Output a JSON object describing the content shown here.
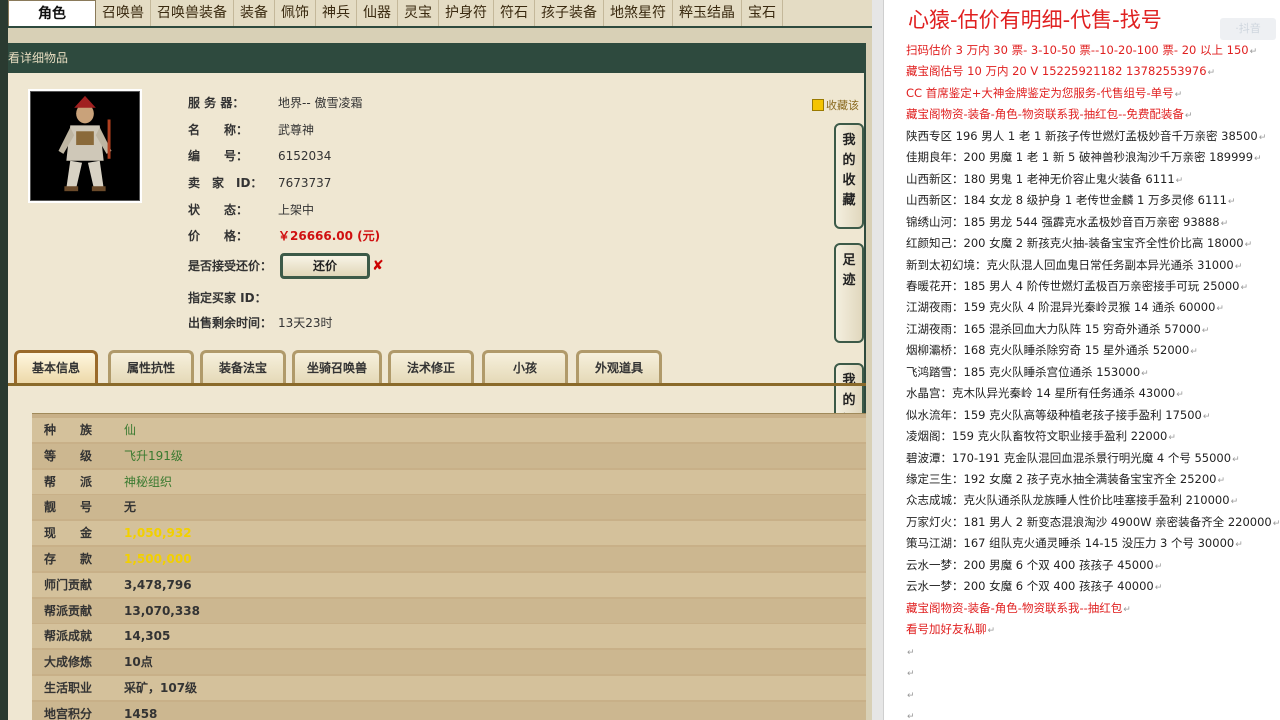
{
  "nav": {
    "tabs": [
      "角色",
      "召唤兽",
      "召唤兽装备",
      "装备",
      "佩饰",
      "神兵",
      "仙器",
      "灵宝",
      "护身符",
      "符石",
      "孩子装备",
      "地煞星符",
      "粹玉结晶",
      "宝石"
    ],
    "active_index": 0
  },
  "header": {
    "title": "看详细物品"
  },
  "item": {
    "fields": [
      {
        "label": "服 务 器：",
        "value": "地界-- 傲雪凌霜"
      },
      {
        "label": "名　　称：",
        "value": "武尊神"
      },
      {
        "label": "编　　号：",
        "value": "6152034"
      },
      {
        "label": "卖　家　ID：",
        "value": "7673737"
      },
      {
        "label": "状　　态：",
        "value": "上架中"
      },
      {
        "label": "价　　格：",
        "value": "￥26666.00 (元)"
      },
      {
        "label": "是否接受还价：",
        "value": ""
      },
      {
        "label": "指定买家 ID：",
        "value": ""
      },
      {
        "label": "出售剩余时间：",
        "value": "13天23时"
      }
    ],
    "counter_offer_button": "还价",
    "favorite_link": "收藏该",
    "side_buttons": [
      "我的收藏",
      "足迹",
      "我的还价"
    ]
  },
  "info_tabs": [
    "基本信息",
    "属性抗性",
    "装备法宝",
    "坐骑召唤兽",
    "法术修正",
    "小孩",
    "外观道具"
  ],
  "info_active": 0,
  "stats": [
    {
      "k": "种　　族",
      "v": "仙",
      "style": "green"
    },
    {
      "k": "等　　级",
      "v": "飞升191级",
      "style": "green"
    },
    {
      "k": "帮　　派",
      "v": "神秘组织",
      "style": "green"
    },
    {
      "k": "靓　　号",
      "v": "无",
      "style": "plain"
    },
    {
      "k": "现　　金",
      "v": "1,050,932",
      "style": "yellow"
    },
    {
      "k": "存　　款",
      "v": "1,500,000",
      "style": "yellow"
    },
    {
      "k": "师门贡献",
      "v": "3,478,796",
      "style": "plain"
    },
    {
      "k": "帮派贡献",
      "v": "13,070,338",
      "style": "plain"
    },
    {
      "k": "帮派成就",
      "v": "14,305",
      "style": "plain"
    },
    {
      "k": "大成修炼",
      "v": "10点",
      "style": "plain"
    },
    {
      "k": "生活职业",
      "v": "采矿，107级",
      "style": "plain"
    },
    {
      "k": "地宫积分",
      "v": "1458",
      "style": "plain"
    }
  ],
  "notes": {
    "title": "心猿-估价有明细-代售-找号",
    "watermark": "·抖音",
    "lines": [
      {
        "t": "扫码估价 3 万内 30 票- 3-10-50 票--10-20-100 票- 20 以上 150",
        "c": "red"
      },
      {
        "t": "藏宝阁估号 10 万内 20 V 15225921182    13782553976",
        "c": "red"
      },
      {
        "t": "CC 首席鉴定+大神金牌鉴定为您服务-代售组号-单号",
        "c": "red"
      },
      {
        "t": "藏宝阁物资-装备-角色-物资联系我-抽红包--免费配装备",
        "c": "red"
      },
      {
        "t": "陕西专区 196 男人 1 老 1 新孩子传世燃灯孟极妙音千万亲密 38500",
        "c": "black"
      },
      {
        "t": "佳期良年：200 男魔 1 老 1 新 5 破神兽秒浪淘沙千万亲密 189999",
        "c": "black"
      },
      {
        "t": "山西新区：180 男鬼 1 老神无价容止鬼火装备 6111",
        "c": "black"
      },
      {
        "t": "山西新区：184 女龙 8 级护身 1 老传世金麟 1 万多灵修 6111",
        "c": "black"
      },
      {
        "t": "锦绣山河：185 男龙 544 强霹克水孟极妙音百万亲密 93888",
        "c": "black"
      },
      {
        "t": "红颜知己：200 女魔 2 新孩克火抽-装备宝宝齐全性价比高 18000",
        "c": "black"
      },
      {
        "t": "新到太初幻境：克火队混人回血鬼日常任务副本异光通杀 31000",
        "c": "black"
      },
      {
        "t": "春暖花开：185 男人 4 阶传世燃灯孟极百万亲密接手可玩 25000",
        "c": "black"
      },
      {
        "t": "江湖夜雨：159 克火队 4 阶混异光秦岭灵猴 14 通杀 60000",
        "c": "black"
      },
      {
        "t": "江湖夜雨：165 混杀回血大力队阵 15 穷奇外通杀 57000",
        "c": "black"
      },
      {
        "t": "烟柳灞桥：168 克火队睡杀除穷奇 15 星外通杀 52000",
        "c": "black"
      },
      {
        "t": "飞鸿踏雪：185 克火队睡杀宫位通杀 153000",
        "c": "black"
      },
      {
        "t": "水晶宫：克木队异光秦岭 14 星所有任务通杀 43000",
        "c": "black"
      },
      {
        "t": "似水流年：159 克火队高等级种植老孩子接手盈利 17500",
        "c": "black"
      },
      {
        "t": "凌烟阁：159 克火队畜牧符文职业接手盈利 22000",
        "c": "black"
      },
      {
        "t": "碧波潭：170-191 克金队混回血混杀景行明光魔 4 个号 55000",
        "c": "black"
      },
      {
        "t": "缘定三生：192 女魔 2 孩子克水抽全满装备宝宝齐全 25200",
        "c": "black"
      },
      {
        "t": "众志成城：克火队通杀队龙族睡人性价比哇塞接手盈利 210000",
        "c": "black"
      },
      {
        "t": "万家灯火：181 男人 2 新变态混浪淘沙 4900W 亲密装备齐全 220000",
        "c": "black"
      },
      {
        "t": "策马江湖：167 组队克火通灵睡杀 14-15 没压力 3 个号 30000",
        "c": "black"
      },
      {
        "t": "云水一梦：200 男魔 6 个双 400 孩孩子 45000",
        "c": "black"
      },
      {
        "t": "云水一梦：200 女魔 6 个双 400 孩孩子 40000",
        "c": "black"
      },
      {
        "t": "藏宝阁物资-装备-角色-物资联系我--抽红包",
        "c": "red"
      },
      {
        "t": "看号加好友私聊",
        "c": "red"
      },
      {
        "t": "",
        "c": "black"
      },
      {
        "t": "",
        "c": "black"
      },
      {
        "t": "",
        "c": "black"
      },
      {
        "t": "",
        "c": "black"
      }
    ]
  }
}
